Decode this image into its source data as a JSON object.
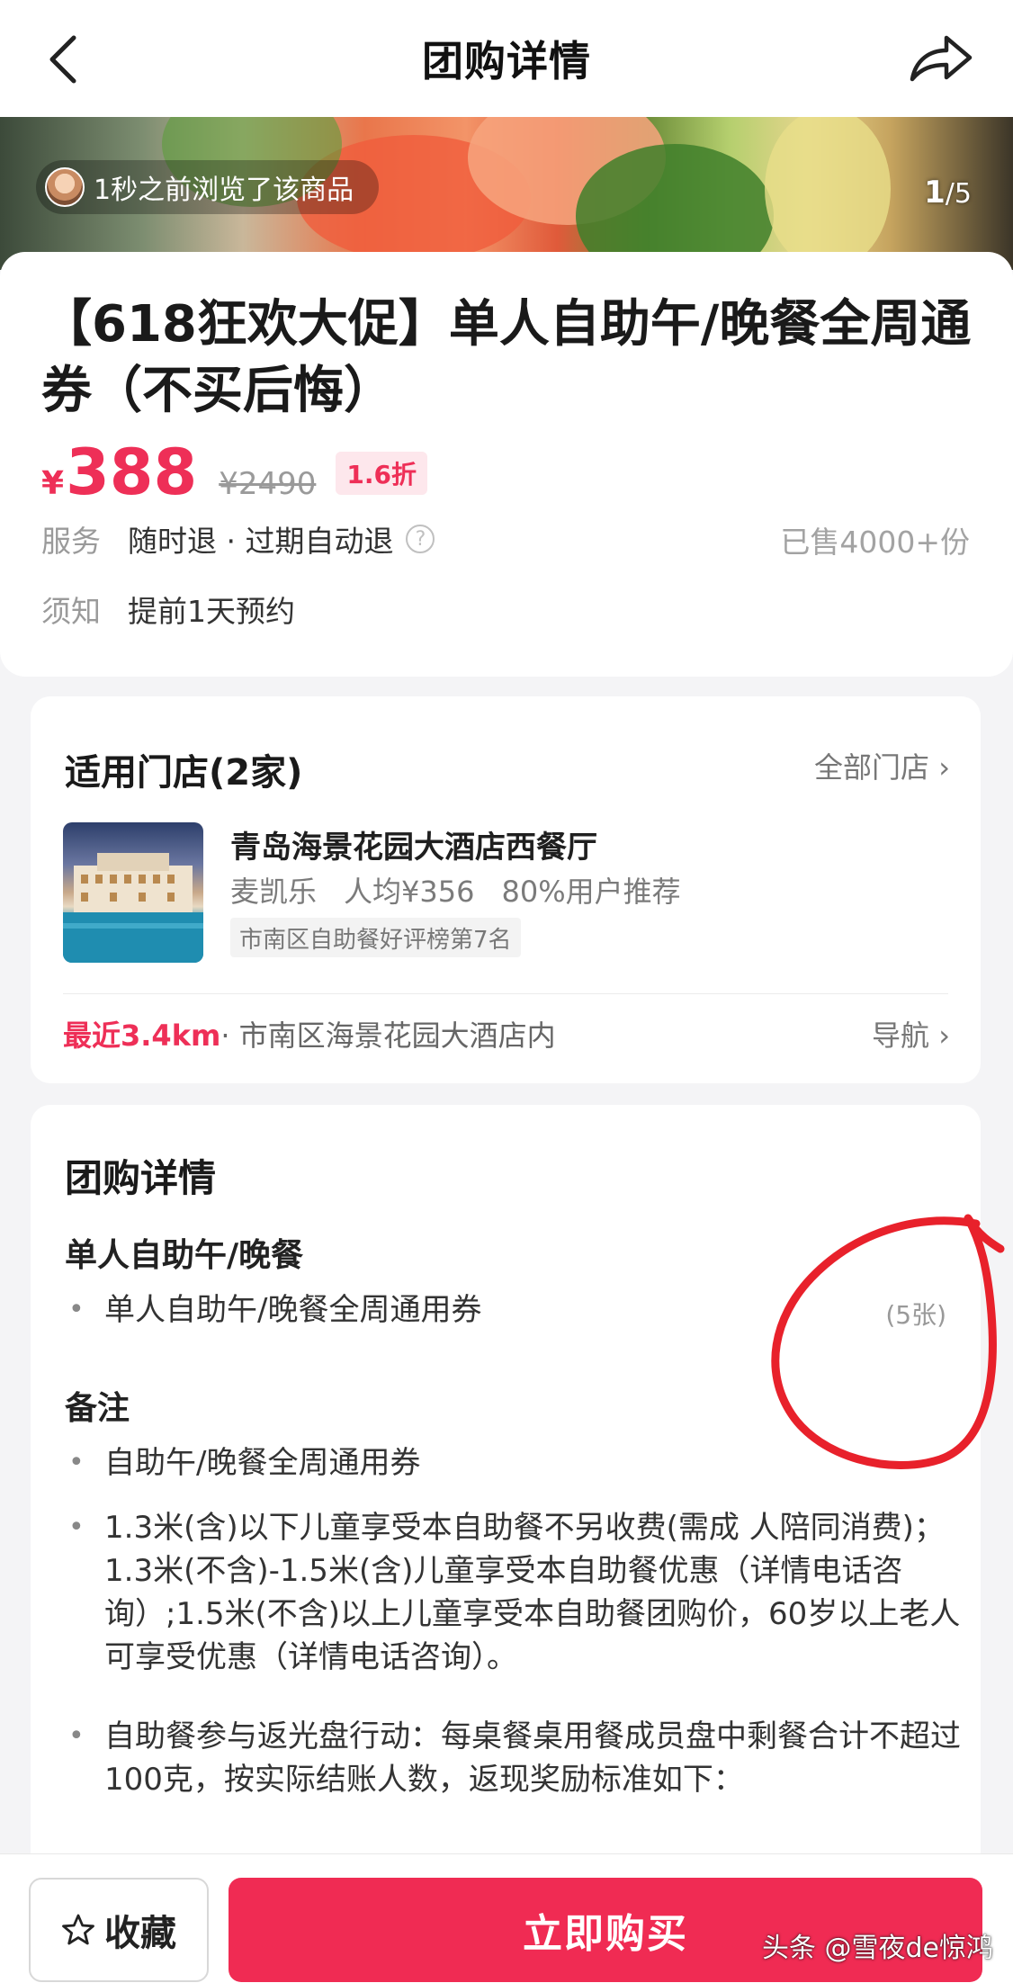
{
  "nav": {
    "title": "团购详情"
  },
  "hero": {
    "viewer_text": "1秒之前浏览了该商品",
    "page_current": "1",
    "page_total": "/5"
  },
  "product": {
    "title": "【618狂欢大促】单人自助午/晚餐全周通券（不买后悔）",
    "price_symbol": "¥",
    "price": "388",
    "original_price": "¥2490",
    "discount": "1.6折",
    "service_label": "服务",
    "service_text": "随时退 · 过期自动退",
    "sold": "已售4000+份",
    "notice_label": "须知",
    "notice_text": "提前1天预约"
  },
  "stores": {
    "title": "适用门店(2家)",
    "all_label": "全部门店 ›",
    "store": {
      "name": "青岛海景花园大酒店西餐厅",
      "brand": "麦凯乐",
      "per_capita": "人均¥356",
      "recommend": "80%用户推荐",
      "rank_tag": "市南区自助餐好评榜第7名"
    },
    "distance": "最近3.4km",
    "address": " · 市南区海景花园大酒店内",
    "nav_label": "导航 ›"
  },
  "details": {
    "title": "团购详情",
    "package_head": "单人自助午/晚餐",
    "package_item": "单人自助午/晚餐全周通用券",
    "package_qty": "(5张)",
    "notes_head": "备注",
    "notes": [
      "自助午/晚餐全周通用券",
      "1.3米(含)以下儿童享受本自助餐不另收费(需成 人陪同消费)；1.3米(不含)-1.5米(含)儿童享受本自助餐优惠（详情电话咨询）;1.5米(不含)以上儿童享受本自助餐团购价，60岁以上老人可享受优惠（详情电话咨询）。",
      "自助餐参与返光盘行动：每桌餐桌用餐成员盘中剩餐合计不超过 100克，按实际结账人数，返现奖励标准如下："
    ]
  },
  "bottom": {
    "favorite_label": "收藏",
    "buy_label": "立即购买"
  },
  "watermark": "头条 @雪夜de惊鸿",
  "colors": {
    "accent": "#ee2f57",
    "buy_button": "#f02b53",
    "annotation": "#e8212b"
  },
  "icons": [
    "back-arrow-icon",
    "share-icon",
    "help-circle-icon",
    "star-outline-icon",
    "bullet-dot-icon"
  ]
}
